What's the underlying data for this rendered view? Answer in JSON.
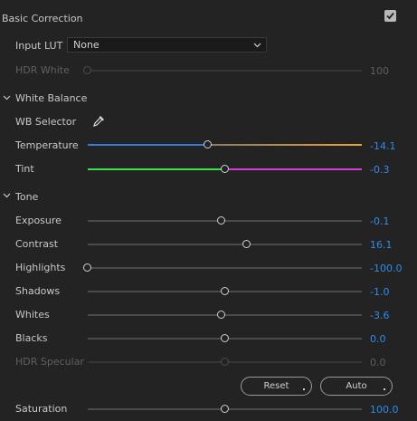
{
  "panel": {
    "title": "Basic Correction",
    "enabled": true
  },
  "input_lut": {
    "label": "Input LUT",
    "value": "None"
  },
  "hdr_white": {
    "label": "HDR White",
    "value": "100",
    "level": 0,
    "enabled": false
  },
  "white_balance": {
    "section_label": "White Balance",
    "wb_selector_label": "WB Selector",
    "temperature": {
      "label": "Temperature",
      "value": "-14.1",
      "level": 0.44
    },
    "tint": {
      "label": "Tint",
      "value": "-0.3",
      "level": 0.5
    }
  },
  "tone": {
    "section_label": "Tone",
    "exposure": {
      "label": "Exposure",
      "value": "-0.1",
      "level": 0.49
    },
    "contrast": {
      "label": "Contrast",
      "value": "16.1",
      "level": 0.58
    },
    "highlights": {
      "label": "Highlights",
      "value": "-100.0",
      "level": 0.0
    },
    "shadows": {
      "label": "Shadows",
      "value": "-1.0",
      "level": 0.5
    },
    "whites": {
      "label": "Whites",
      "value": "-3.6",
      "level": 0.49
    },
    "blacks": {
      "label": "Blacks",
      "value": "0.0",
      "level": 0.5
    },
    "hdr_specular": {
      "label": "HDR Specular",
      "value": "0.0",
      "level": 0.5,
      "enabled": false
    },
    "reset_label": "Reset",
    "auto_label": "Auto"
  },
  "saturation": {
    "label": "Saturation",
    "value": "100.0",
    "level": 0.5
  },
  "colors": {
    "value_blue": "#2d8ceb",
    "temperature_left": "#2f7fd8",
    "temperature_right": "#f0a030",
    "tint_left": "#3be04a",
    "tint_right": "#d43bd4"
  }
}
